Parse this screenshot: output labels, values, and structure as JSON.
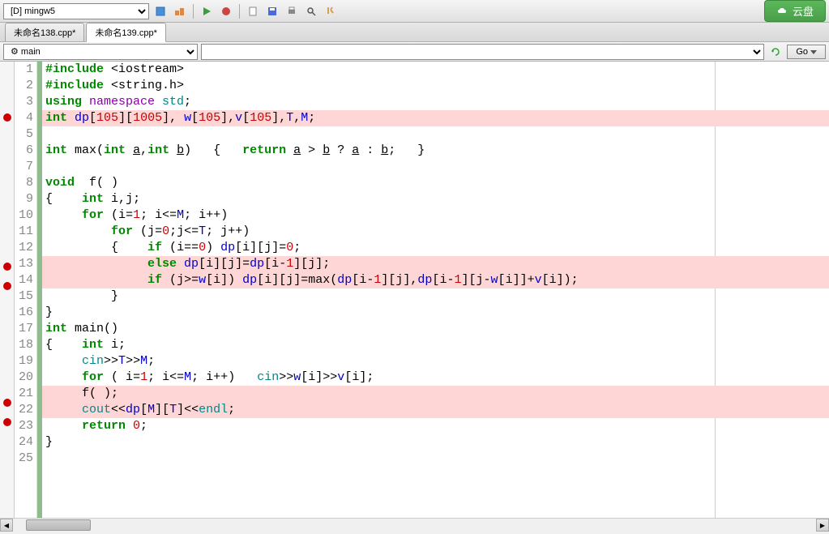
{
  "toolbar": {
    "compiler": "[D] mingw5",
    "cloud_label": "云盘"
  },
  "tabs": [
    {
      "label": "未命名138.cpp*",
      "active": false
    },
    {
      "label": "未命名139.cpp*",
      "active": true
    }
  ],
  "funcbar": {
    "function": "main",
    "location": "",
    "go_label": "Go"
  },
  "code": {
    "lines": [
      {
        "n": 1,
        "bp": false,
        "hl": false,
        "tokens": [
          [
            "kw-green",
            "#include "
          ],
          [
            "op",
            "<"
          ],
          [
            "ident",
            "iostream"
          ],
          [
            "op",
            ">"
          ]
        ]
      },
      {
        "n": 2,
        "bp": false,
        "hl": false,
        "tokens": [
          [
            "kw-green",
            "#include "
          ],
          [
            "op",
            "<"
          ],
          [
            "ident",
            "string.h"
          ],
          [
            "op",
            ">"
          ]
        ]
      },
      {
        "n": 3,
        "bp": false,
        "hl": false,
        "tokens": [
          [
            "kw-green",
            "using "
          ],
          [
            "kw-purple",
            "namespace "
          ],
          [
            "kw-teal",
            "std"
          ],
          [
            "op",
            ";"
          ]
        ]
      },
      {
        "n": 4,
        "bp": true,
        "hl": true,
        "tokens": [
          [
            "kw-green",
            "int "
          ],
          [
            "kw-blue",
            "dp"
          ],
          [
            "op",
            "["
          ],
          [
            "num-red",
            "105"
          ],
          [
            "op",
            "]["
          ],
          [
            "num-red",
            "1005"
          ],
          [
            "op",
            "], "
          ],
          [
            "kw-blue",
            "w"
          ],
          [
            "op",
            "["
          ],
          [
            "num-red",
            "105"
          ],
          [
            "op",
            "],"
          ],
          [
            "kw-blue",
            "v"
          ],
          [
            "op",
            "["
          ],
          [
            "num-red",
            "105"
          ],
          [
            "op",
            "],"
          ],
          [
            "kw-blue",
            "T"
          ],
          [
            "op",
            ","
          ],
          [
            "kw-blue",
            "M"
          ],
          [
            "op",
            ";"
          ]
        ]
      },
      {
        "n": 5,
        "bp": false,
        "hl": false,
        "tokens": []
      },
      {
        "n": 6,
        "bp": false,
        "hl": false,
        "tokens": [
          [
            "kw-green",
            "int "
          ],
          [
            "ident",
            "max"
          ],
          [
            "op",
            "("
          ],
          [
            "kw-green",
            "int "
          ],
          [
            "ident underline",
            "a"
          ],
          [
            "op",
            ","
          ],
          [
            "kw-green",
            "int "
          ],
          [
            "ident underline",
            "b"
          ],
          [
            "op",
            ")   {   "
          ],
          [
            "kw-green",
            "return "
          ],
          [
            "ident underline",
            "a"
          ],
          [
            "op",
            " > "
          ],
          [
            "ident underline",
            "b"
          ],
          [
            "op",
            " ? "
          ],
          [
            "ident underline",
            "a"
          ],
          [
            "op",
            " : "
          ],
          [
            "ident underline",
            "b"
          ],
          [
            "op",
            ";   }"
          ]
        ]
      },
      {
        "n": 7,
        "bp": false,
        "hl": false,
        "tokens": []
      },
      {
        "n": 8,
        "bp": false,
        "hl": false,
        "tokens": [
          [
            "kw-green",
            "void  "
          ],
          [
            "ident",
            "f"
          ],
          [
            "op",
            "( )"
          ]
        ]
      },
      {
        "n": 9,
        "bp": false,
        "hl": false,
        "tokens": [
          [
            "op",
            "{    "
          ],
          [
            "kw-green",
            "int "
          ],
          [
            "ident",
            "i"
          ],
          [
            "op",
            ","
          ],
          [
            "ident",
            "j"
          ],
          [
            "op",
            ";"
          ]
        ]
      },
      {
        "n": 10,
        "bp": false,
        "hl": false,
        "tokens": [
          [
            "op",
            "     "
          ],
          [
            "kw-green",
            "for "
          ],
          [
            "op",
            "("
          ],
          [
            "ident",
            "i"
          ],
          [
            "op",
            "="
          ],
          [
            "num-red",
            "1"
          ],
          [
            "op",
            "; "
          ],
          [
            "ident",
            "i"
          ],
          [
            "op",
            "<="
          ],
          [
            "kw-blue",
            "M"
          ],
          [
            "op",
            "; "
          ],
          [
            "ident",
            "i"
          ],
          [
            "op",
            "++)"
          ]
        ]
      },
      {
        "n": 11,
        "bp": false,
        "hl": false,
        "tokens": [
          [
            "op",
            "         "
          ],
          [
            "kw-green",
            "for "
          ],
          [
            "op",
            "("
          ],
          [
            "ident",
            "j"
          ],
          [
            "op",
            "="
          ],
          [
            "num-red",
            "0"
          ],
          [
            "op",
            ";"
          ],
          [
            "ident",
            "j"
          ],
          [
            "op",
            "<="
          ],
          [
            "kw-blue",
            "T"
          ],
          [
            "op",
            "; "
          ],
          [
            "ident",
            "j"
          ],
          [
            "op",
            "++)"
          ]
        ]
      },
      {
        "n": 12,
        "bp": false,
        "hl": false,
        "tokens": [
          [
            "op",
            "         {    "
          ],
          [
            "kw-green",
            "if "
          ],
          [
            "op",
            "("
          ],
          [
            "ident",
            "i"
          ],
          [
            "op",
            "=="
          ],
          [
            "num-red",
            "0"
          ],
          [
            "op",
            ") "
          ],
          [
            "kw-blue",
            "dp"
          ],
          [
            "op",
            "["
          ],
          [
            "ident",
            "i"
          ],
          [
            "op",
            "]["
          ],
          [
            "ident",
            "j"
          ],
          [
            "op",
            "]="
          ],
          [
            "num-red",
            "0"
          ],
          [
            "op",
            ";"
          ]
        ]
      },
      {
        "n": 13,
        "bp": true,
        "hl": true,
        "tokens": [
          [
            "op",
            "              "
          ],
          [
            "kw-green",
            "else "
          ],
          [
            "kw-blue",
            "dp"
          ],
          [
            "op",
            "["
          ],
          [
            "ident",
            "i"
          ],
          [
            "op",
            "]["
          ],
          [
            "ident",
            "j"
          ],
          [
            "op",
            "]="
          ],
          [
            "kw-blue",
            "dp"
          ],
          [
            "op",
            "["
          ],
          [
            "ident",
            "i"
          ],
          [
            "op",
            "-"
          ],
          [
            "num-red",
            "1"
          ],
          [
            "op",
            "]["
          ],
          [
            "ident",
            "j"
          ],
          [
            "op",
            "];"
          ]
        ]
      },
      {
        "n": 14,
        "bp": true,
        "hl": true,
        "tokens": [
          [
            "op",
            "              "
          ],
          [
            "kw-green",
            "if "
          ],
          [
            "op",
            "("
          ],
          [
            "ident",
            "j"
          ],
          [
            "op",
            ">="
          ],
          [
            "kw-blue",
            "w"
          ],
          [
            "op",
            "["
          ],
          [
            "ident",
            "i"
          ],
          [
            "op",
            "]) "
          ],
          [
            "kw-blue",
            "dp"
          ],
          [
            "op",
            "["
          ],
          [
            "ident",
            "i"
          ],
          [
            "op",
            "]["
          ],
          [
            "ident",
            "j"
          ],
          [
            "op",
            "]="
          ],
          [
            "ident",
            "max"
          ],
          [
            "op",
            "("
          ],
          [
            "kw-blue",
            "dp"
          ],
          [
            "op",
            "["
          ],
          [
            "ident",
            "i"
          ],
          [
            "op",
            "-"
          ],
          [
            "num-red",
            "1"
          ],
          [
            "op",
            "]["
          ],
          [
            "ident",
            "j"
          ],
          [
            "op",
            "],"
          ],
          [
            "kw-blue",
            "dp"
          ],
          [
            "op",
            "["
          ],
          [
            "ident",
            "i"
          ],
          [
            "op",
            "-"
          ],
          [
            "num-red",
            "1"
          ],
          [
            "op",
            "]["
          ],
          [
            "ident",
            "j"
          ],
          [
            "op",
            "-"
          ],
          [
            "kw-blue",
            "w"
          ],
          [
            "op",
            "["
          ],
          [
            "ident",
            "i"
          ],
          [
            "op",
            "]]+"
          ],
          [
            "kw-blue",
            "v"
          ],
          [
            "op",
            "["
          ],
          [
            "ident",
            "i"
          ],
          [
            "op",
            "]);"
          ]
        ]
      },
      {
        "n": 15,
        "bp": false,
        "hl": false,
        "tokens": [
          [
            "op",
            "         }"
          ]
        ]
      },
      {
        "n": 16,
        "bp": false,
        "hl": false,
        "tokens": [
          [
            "op",
            "}"
          ]
        ]
      },
      {
        "n": 17,
        "bp": false,
        "hl": false,
        "tokens": [
          [
            "kw-green",
            "int "
          ],
          [
            "ident",
            "main"
          ],
          [
            "op",
            "()"
          ]
        ]
      },
      {
        "n": 18,
        "bp": false,
        "hl": false,
        "tokens": [
          [
            "op",
            "{    "
          ],
          [
            "kw-green",
            "int "
          ],
          [
            "ident",
            "i"
          ],
          [
            "op",
            ";"
          ]
        ]
      },
      {
        "n": 19,
        "bp": false,
        "hl": false,
        "tokens": [
          [
            "op",
            "     "
          ],
          [
            "kw-teal",
            "cin"
          ],
          [
            "op",
            ">>"
          ],
          [
            "kw-blue",
            "T"
          ],
          [
            "op",
            ">>"
          ],
          [
            "kw-blue",
            "M"
          ],
          [
            "op",
            ";"
          ]
        ]
      },
      {
        "n": 20,
        "bp": false,
        "hl": false,
        "tokens": [
          [
            "op",
            "     "
          ],
          [
            "kw-green",
            "for "
          ],
          [
            "op",
            "( "
          ],
          [
            "ident",
            "i"
          ],
          [
            "op",
            "="
          ],
          [
            "num-red",
            "1"
          ],
          [
            "op",
            "; "
          ],
          [
            "ident",
            "i"
          ],
          [
            "op",
            "<="
          ],
          [
            "kw-blue",
            "M"
          ],
          [
            "op",
            "; "
          ],
          [
            "ident",
            "i"
          ],
          [
            "op",
            "++)   "
          ],
          [
            "kw-teal",
            "cin"
          ],
          [
            "op",
            ">>"
          ],
          [
            "kw-blue",
            "w"
          ],
          [
            "op",
            "["
          ],
          [
            "ident",
            "i"
          ],
          [
            "op",
            "]>>"
          ],
          [
            "kw-blue",
            "v"
          ],
          [
            "op",
            "["
          ],
          [
            "ident",
            "i"
          ],
          [
            "op",
            "];"
          ]
        ]
      },
      {
        "n": 21,
        "bp": true,
        "hl": true,
        "tokens": [
          [
            "op",
            "     "
          ],
          [
            "ident",
            "f"
          ],
          [
            "op",
            "( );"
          ]
        ]
      },
      {
        "n": 22,
        "bp": true,
        "hl": true,
        "tokens": [
          [
            "op",
            "     "
          ],
          [
            "kw-teal",
            "cout"
          ],
          [
            "op",
            "<<"
          ],
          [
            "kw-blue",
            "dp"
          ],
          [
            "op",
            "["
          ],
          [
            "kw-blue",
            "M"
          ],
          [
            "op",
            "]["
          ],
          [
            "kw-blue",
            "T"
          ],
          [
            "op",
            "]<<"
          ],
          [
            "kw-teal",
            "endl"
          ],
          [
            "op",
            ";"
          ]
        ]
      },
      {
        "n": 23,
        "bp": false,
        "hl": false,
        "tokens": [
          [
            "op",
            "     "
          ],
          [
            "kw-green",
            "return "
          ],
          [
            "num-red",
            "0"
          ],
          [
            "op",
            ";"
          ]
        ]
      },
      {
        "n": 24,
        "bp": false,
        "hl": false,
        "tokens": [
          [
            "op",
            "}"
          ]
        ]
      },
      {
        "n": 25,
        "bp": false,
        "hl": false,
        "tokens": []
      }
    ]
  }
}
